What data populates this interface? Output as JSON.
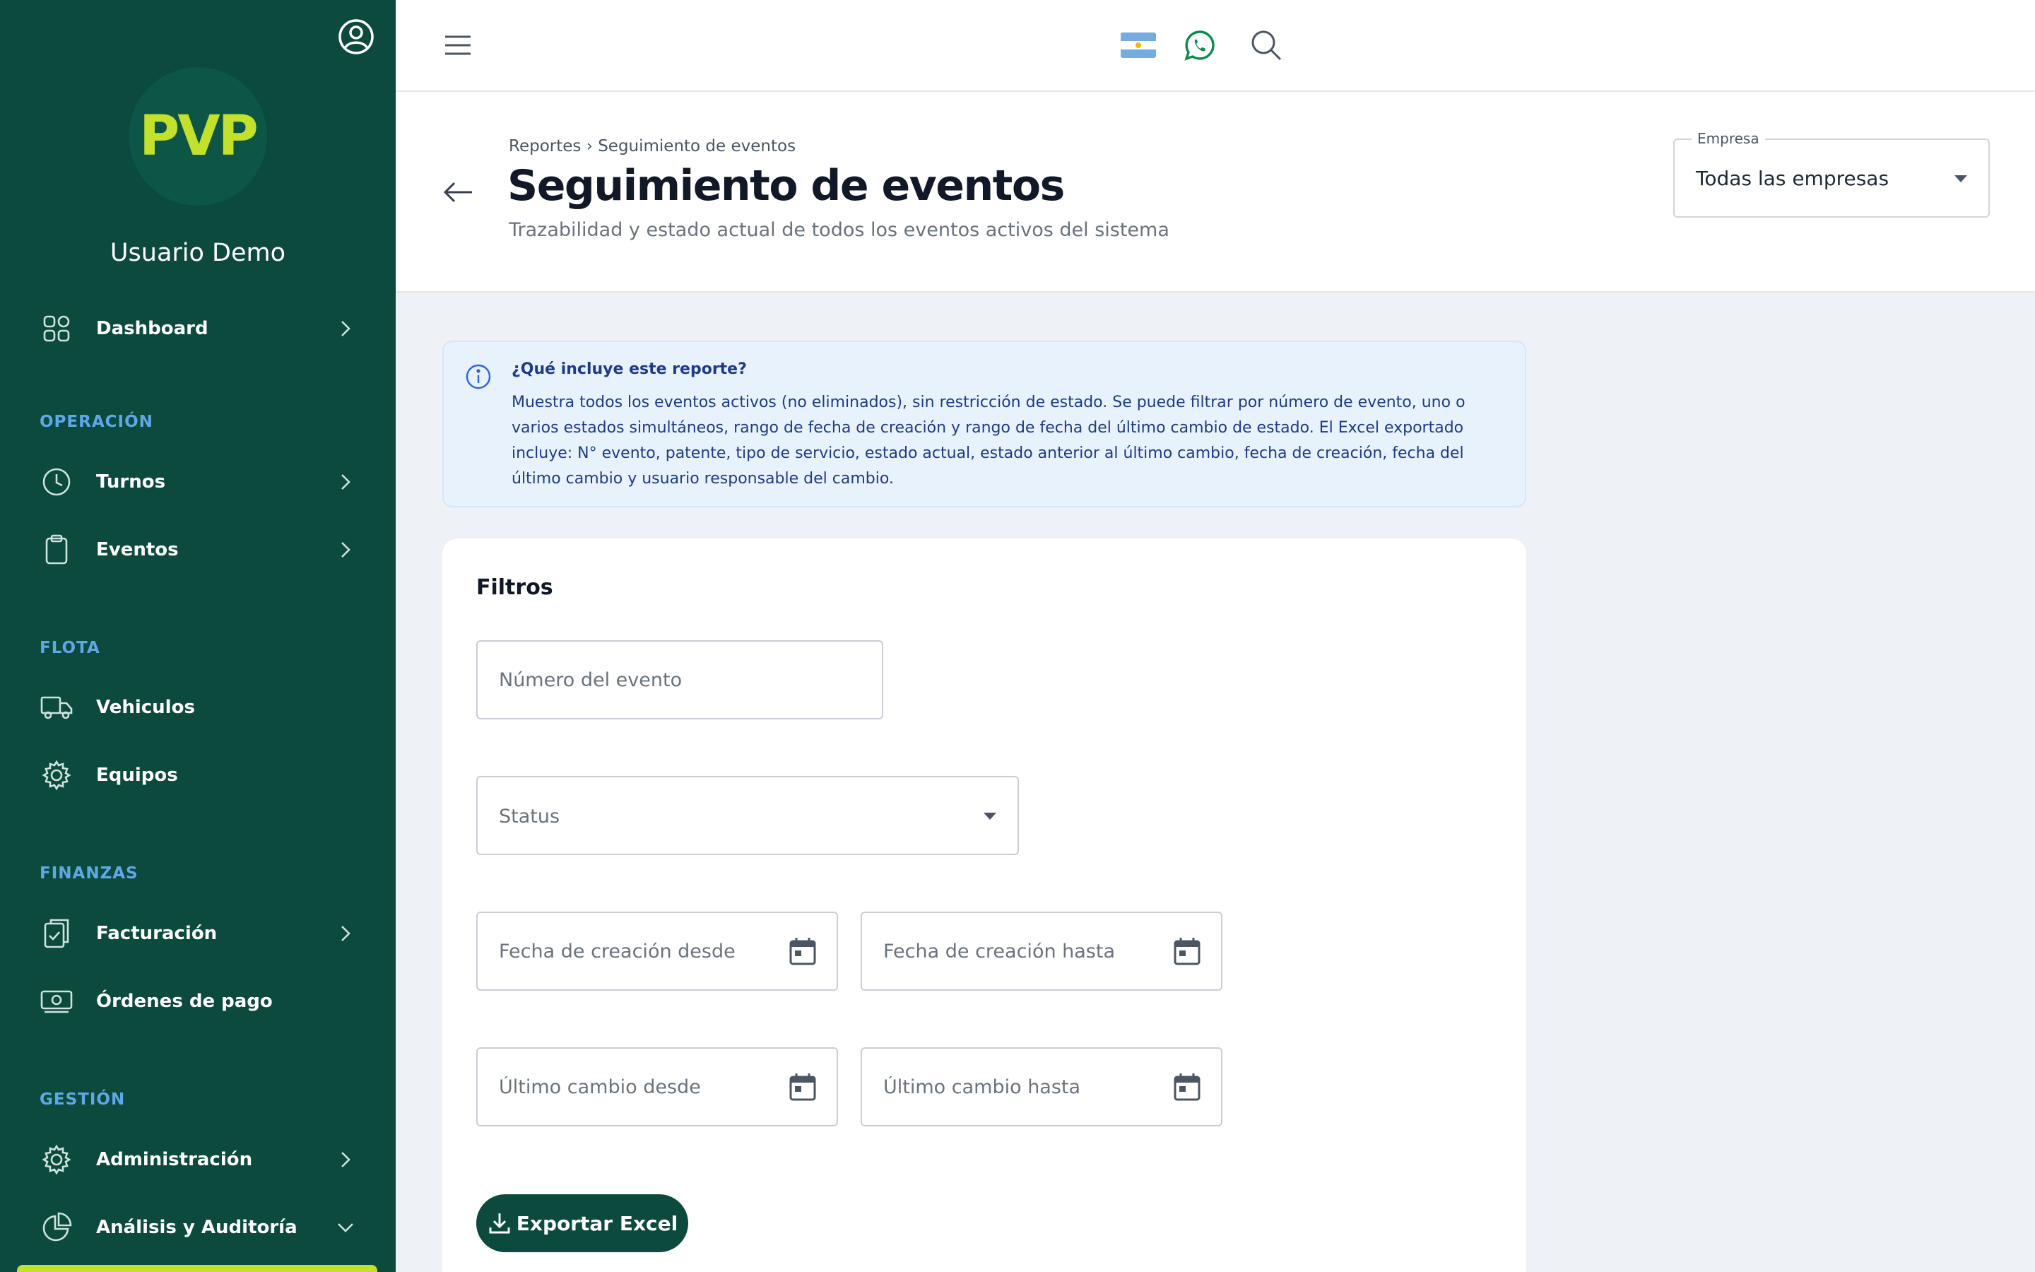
{
  "sidebar": {
    "logo_text": "PVP",
    "user_name": "Usuario Demo",
    "dashboard": "Dashboard",
    "sections": {
      "operacion": "OPERACIÓN",
      "flota": "FLOTA",
      "finanzas": "FINANZAS",
      "gestion": "GESTIÓN"
    },
    "items": {
      "turnos": "Turnos",
      "eventos": "Eventos",
      "vehiculos": "Vehiculos",
      "equipos": "Equipos",
      "facturacion": "Facturación",
      "ordenes": "Órdenes de pago",
      "administracion": "Administración",
      "analisis": "Análisis y Auditoría"
    }
  },
  "header": {
    "breadcrumb": "Reportes › Seguimiento de eventos",
    "title": "Seguimiento de eventos",
    "subtitle": "Trazabilidad y estado actual de todos los eventos activos del sistema",
    "company_label": "Empresa",
    "company_value": "Todas las empresas"
  },
  "info": {
    "title": "¿Qué incluye este reporte?",
    "body": "Muestra todos los eventos activos (no eliminados), sin restricción de estado. Se puede filtrar por número de evento, uno o varios estados simultáneos, rango de fecha de creación y rango de fecha del último cambio de estado. El Excel exportado incluye: N° evento, patente, tipo de servicio, estado actual, estado anterior al último cambio, fecha de creación, fecha del último cambio y usuario responsable del cambio."
  },
  "filters": {
    "title": "Filtros",
    "event_number_placeholder": "Número del evento",
    "status_label": "Status",
    "created_from_placeholder": "Fecha de creación desde",
    "created_to_placeholder": "Fecha de creación hasta",
    "last_change_from_placeholder": "Último cambio desde",
    "last_change_to_placeholder": "Último cambio hasta",
    "export_label": "Exportar Excel"
  },
  "colors": {
    "sidebar_bg": "#0b4a3c",
    "accent_lime": "#c3e02d",
    "section_title": "#5fa8e8",
    "info_bg": "#e8f2fc"
  }
}
